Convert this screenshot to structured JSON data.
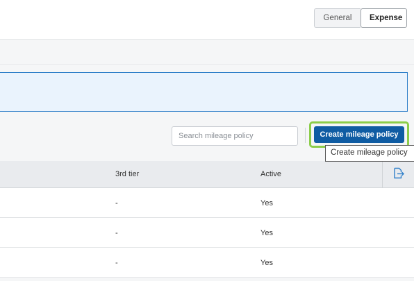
{
  "header": {
    "tabs": [
      {
        "label": "General",
        "active": false
      },
      {
        "label": "Expense",
        "active": true
      }
    ]
  },
  "toolbar": {
    "search_placeholder": "Search mileage policy",
    "create_label": "Create mileage policy",
    "tooltip": "Create mileage policy"
  },
  "table": {
    "columns": [
      "3rd tier",
      "Active"
    ],
    "rows": [
      {
        "tier3": "-",
        "active": "Yes"
      },
      {
        "tier3": "-",
        "active": "Yes"
      },
      {
        "tier3": "-",
        "active": "Yes"
      }
    ]
  },
  "colors": {
    "primary": "#0f5ca3",
    "highlight": "#8ccd4a",
    "banner_border": "#2f7fc9",
    "banner_bg": "#eaf3fd"
  },
  "icons": {
    "export": "export-icon"
  }
}
